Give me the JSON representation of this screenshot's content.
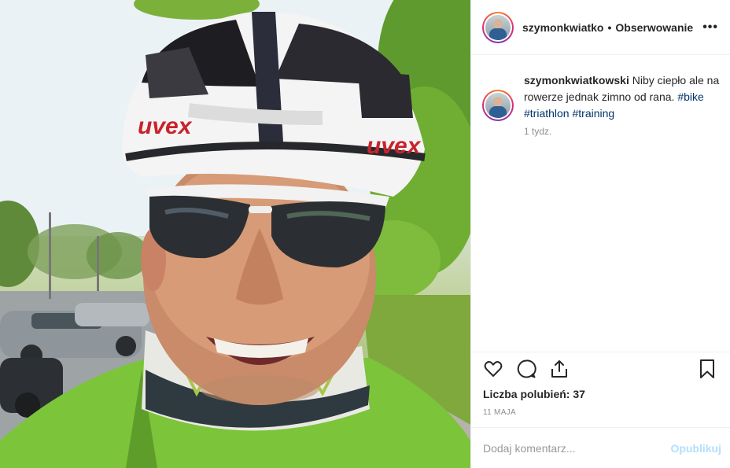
{
  "post": {
    "username": "szymonkwiatko",
    "separator": "•",
    "follow_label": "Obserwowanie",
    "more_label": "•••",
    "caption_username": "szymonkwiatkowski",
    "caption_text": " Niby ciepło ale na rowerze jednak zimno od rana. ",
    "hashtags": [
      "#bike",
      "#triathlon",
      "#training"
    ],
    "relative_time": "1 tydz.",
    "likes_text": "Liczba polubień: 37",
    "date": "11 MAJA",
    "comment_placeholder": "Dodaj komentarz...",
    "post_button": "Opublikuj",
    "helmet_brand": "uvex"
  },
  "icons": {
    "more": "more-options-icon",
    "like": "heart-icon",
    "comment": "comment-icon",
    "share": "share-icon",
    "save": "bookmark-icon"
  },
  "colors": {
    "hashtag": "#003569",
    "post_button_disabled": "#b2dffc",
    "muted": "#8e8e8e",
    "jacket_green": "#7cc43a"
  }
}
